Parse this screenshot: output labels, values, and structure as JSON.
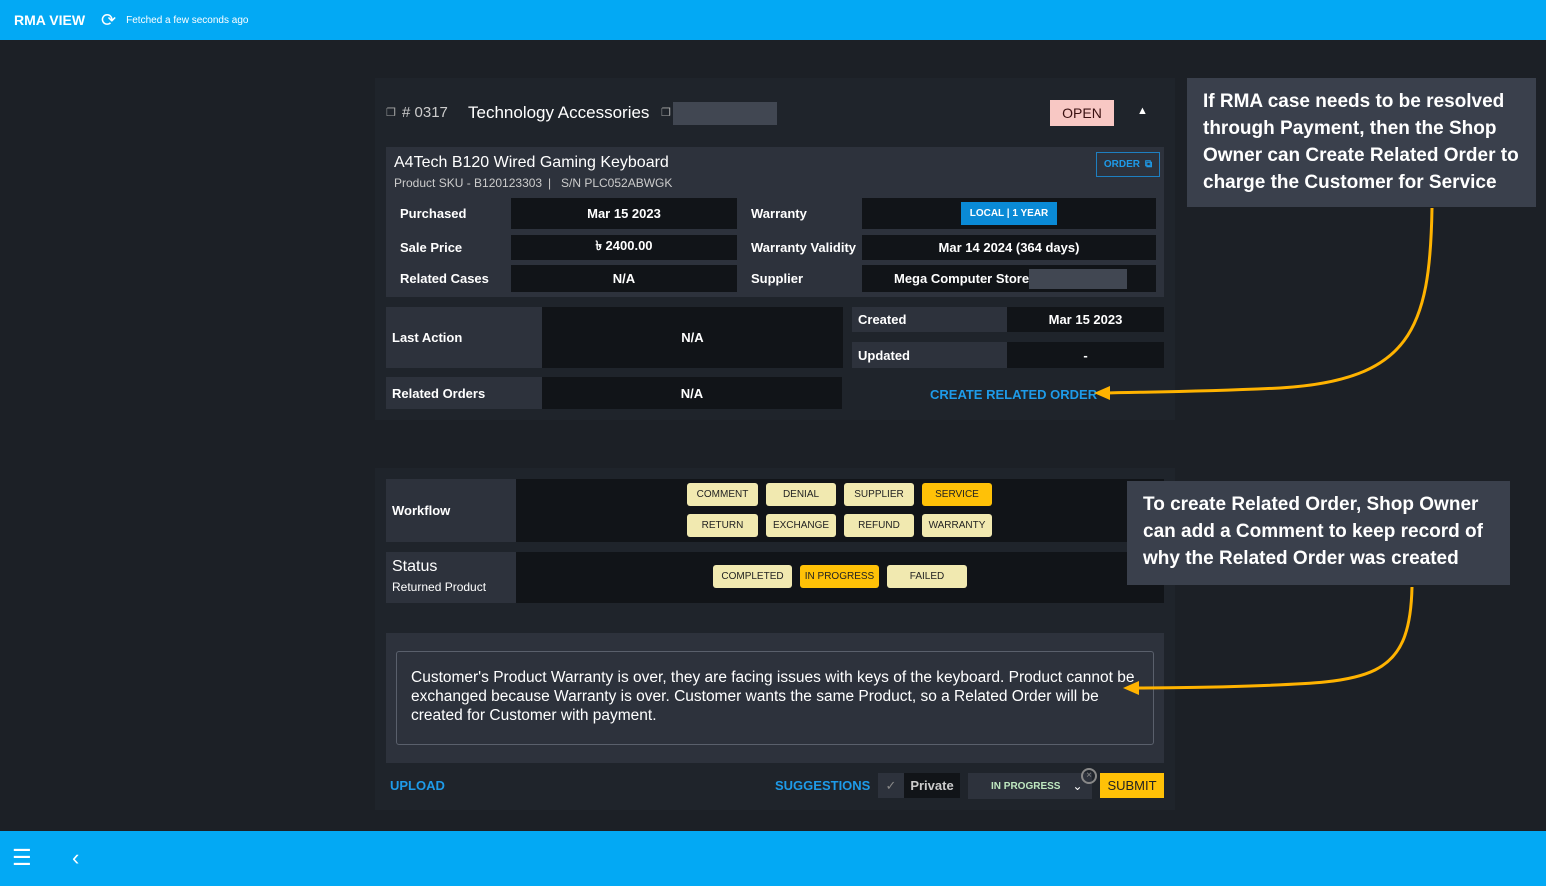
{
  "header": {
    "title": "RMA VIEW",
    "fetched": "Fetched a few seconds ago"
  },
  "case": {
    "number": "# 0317",
    "category": "Technology Accessories",
    "status": "OPEN",
    "product": {
      "name": "A4Tech B120 Wired Gaming Keyboard",
      "sku": "Product SKU - B120123303",
      "serial": "S/N PLC052ABWGK",
      "order_label": "ORDER"
    },
    "details": [
      {
        "label": "Purchased",
        "value": "Mar 15 2023"
      },
      {
        "label": "Sale Price",
        "value": "৳ 2400.00"
      },
      {
        "label": "Related Cases",
        "value": "N/A"
      },
      {
        "label": "Warranty",
        "value": "LOCAL | 1 YEAR"
      },
      {
        "label": "Warranty Validity",
        "value": "Mar 14 2024 (364 days)"
      },
      {
        "label": "Supplier",
        "value": "Mega Computer Store"
      }
    ],
    "last_action": {
      "label": "Last Action",
      "value": "N/A"
    },
    "created": {
      "label": "Created",
      "value": "Mar 15 2023"
    },
    "updated": {
      "label": "Updated",
      "value": "-"
    },
    "related_orders": {
      "label": "Related Orders",
      "value": "N/A"
    },
    "create_related_order": "CREATE RELATED ORDER"
  },
  "workflow": {
    "label": "Workflow",
    "options": [
      "COMMENT",
      "DENIAL",
      "SUPPLIER",
      "SERVICE",
      "RETURN",
      "EXCHANGE",
      "REFUND",
      "WARRANTY"
    ],
    "selected": "SERVICE"
  },
  "status": {
    "label": "Status",
    "sub": "Returned Product",
    "options": [
      "COMPLETED",
      "IN PROGRESS",
      "FAILED"
    ],
    "selected": "IN PROGRESS"
  },
  "comment": {
    "text": "Customer's Product Warranty is over, they are facing issues with keys of the keyboard. Product cannot be exchanged because Warranty is over. Customer wants the same Product, so a Related Order will be created for Customer with payment."
  },
  "footer": {
    "upload": "UPLOAD",
    "suggestions": "SUGGESTIONS",
    "private": "Private",
    "status_select": "IN PROGRESS",
    "submit": "SUBMIT"
  },
  "callouts": [
    "If RMA case needs to be resolved through Payment, then the Shop Owner can Create Related Order to charge the Customer for Service",
    "To create Related Order, Shop Owner can add a Comment to keep record of why the Related Order was created"
  ],
  "colors": {
    "accent": "#03a9f4",
    "selected": "#ffc107",
    "chip": "#f1e9b0",
    "open_badge": "#f8c8c4",
    "arrow": "#ffb300"
  }
}
